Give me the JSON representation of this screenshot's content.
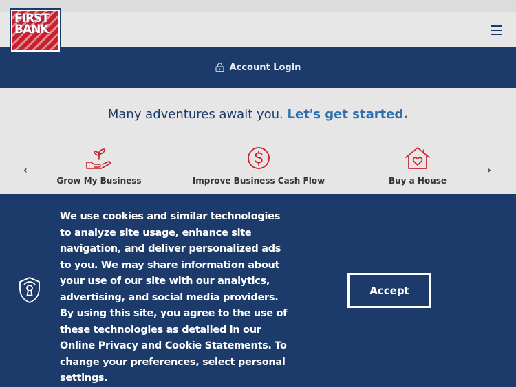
{
  "logo": {
    "line1": "FIRST",
    "line2": "BANK"
  },
  "header": {
    "login_label": "Account Login"
  },
  "hero": {
    "headline": "Many adventures await you.",
    "cta_link": "Let's get started."
  },
  "carousel": {
    "prev_icon": "chevron-left-icon",
    "next_icon": "chevron-right-icon",
    "items": [
      {
        "label": "Grow My Business",
        "icon": "plant-hand-icon"
      },
      {
        "label": "Improve Business Cash Flow",
        "icon": "dollar-circle-icon"
      },
      {
        "label": "Buy a House",
        "icon": "house-heart-icon"
      }
    ]
  },
  "cookie_banner": {
    "text": "We use cookies and similar technologies to analyze site usage, enhance site navigation, and deliver personalized ads to you. We may share information about your use of our site with our analytics, advertising, and social media providers. By using this site, you agree to the use of these technologies as detailed in our Online Privacy and Cookie Statements. To change your preferences, select ",
    "link_text": "personal settings.",
    "accept_label": "Accept"
  },
  "colors": {
    "navy": "#1c3b6b",
    "accent_red": "#c8202f",
    "link_blue": "#2e6fb0"
  }
}
